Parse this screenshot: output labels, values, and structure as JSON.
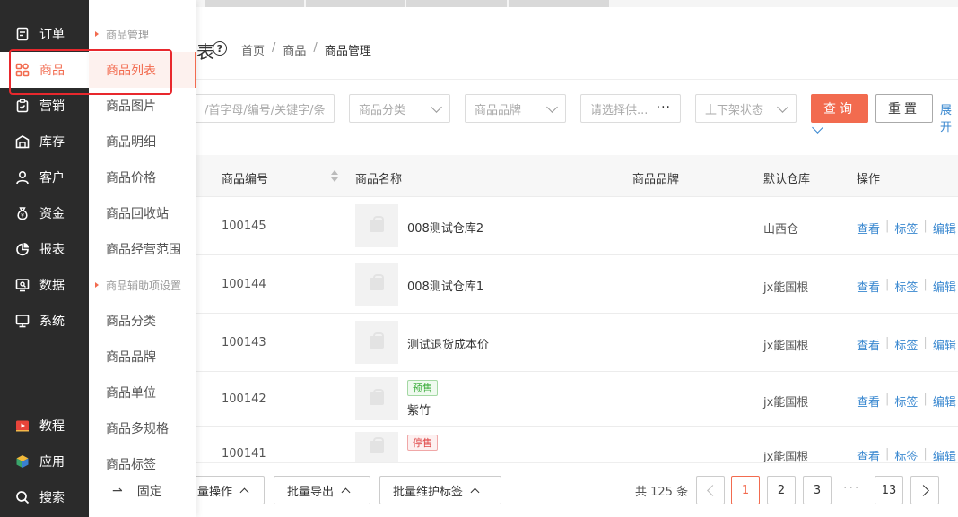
{
  "nav": {
    "items": [
      {
        "label": "订单",
        "icon": "order-icon"
      },
      {
        "label": "商品",
        "icon": "goods-grid-icon"
      },
      {
        "label": "营销",
        "icon": "marketing-icon"
      },
      {
        "label": "库存",
        "icon": "warehouse-icon"
      },
      {
        "label": "客户",
        "icon": "customer-icon"
      },
      {
        "label": "资金",
        "icon": "money-bag-icon"
      },
      {
        "label": "报表",
        "icon": "pie-chart-icon"
      },
      {
        "label": "数据",
        "icon": "data-screen-icon"
      },
      {
        "label": "系统",
        "icon": "monitor-icon"
      }
    ],
    "bottom_items": [
      {
        "label": "教程",
        "icon": "video-play-icon"
      },
      {
        "label": "应用",
        "icon": "app-cube-icon"
      },
      {
        "label": "搜索",
        "icon": "search-icon"
      }
    ],
    "active_color": "#f26b4f"
  },
  "submenu": {
    "group1": "商品管理",
    "group1_items": [
      "商品列表",
      "商品图片",
      "商品明细",
      "商品价格",
      "商品回收站",
      "商品经营范围"
    ],
    "group2": "商品辅助项设置",
    "group2_items": [
      "商品分类",
      "商品品牌",
      "商品单位",
      "商品多规格",
      "商品标签"
    ],
    "pin_label": "固定"
  },
  "header": {
    "title_fragment": "表",
    "breadcrumbs": [
      "首页",
      "商品",
      "商品管理"
    ]
  },
  "filters": {
    "keyword_placeholder": "/首字母/编号/关键字/条",
    "category_placeholder": "商品分类",
    "brand_placeholder": "商品品牌",
    "supplier_placeholder": "请选择供...",
    "status_placeholder": "上下架状态",
    "query_label": "查询",
    "reset_label": "重置",
    "expand_label": "展开"
  },
  "table": {
    "columns": [
      "商品编号",
      "商品名称",
      "商品品牌",
      "默认仓库",
      "操作"
    ],
    "actions": [
      "查看",
      "标签",
      "编辑"
    ],
    "rows": [
      {
        "code": "100145",
        "name": "008测试仓库2",
        "tag": "",
        "brand": "",
        "warehouse": "山西仓"
      },
      {
        "code": "100144",
        "name": "008测试仓库1",
        "tag": "",
        "brand": "",
        "warehouse": "jx能国根"
      },
      {
        "code": "100143",
        "name": "测试退货成本价",
        "tag": "",
        "brand": "",
        "warehouse": "jx能国根"
      },
      {
        "code": "100142",
        "name": "紫竹",
        "tag": "预售",
        "brand": "",
        "warehouse": "jx能国根"
      },
      {
        "code": "100141",
        "name": "",
        "tag": "停售",
        "brand": "",
        "warehouse": "jx能国根"
      }
    ]
  },
  "footer": {
    "batch_ops_label": "量操作",
    "batch_export_label": "批量导出",
    "batch_tags_label": "批量维护标签",
    "total_text": "共 125 条",
    "pages": [
      "1",
      "2",
      "3",
      "13"
    ],
    "current_page": "1",
    "ellipsis": "···"
  }
}
